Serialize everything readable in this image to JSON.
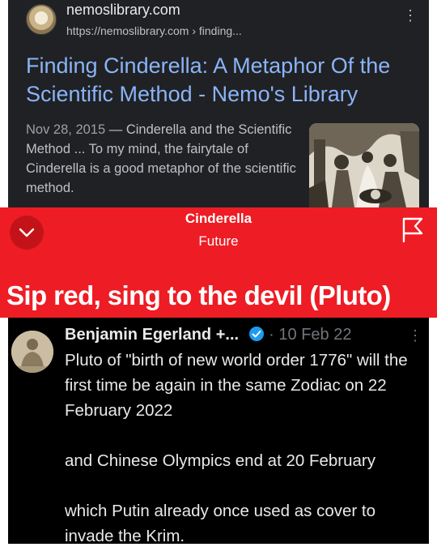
{
  "search_result": {
    "site_name": "nemoslibrary.com",
    "site_url": "https://nemoslibrary.com › finding...",
    "title": "Finding Cinderella: A Metaphor Of the Scientific Method - Nemo's Library",
    "date": "Nov 28, 2015",
    "snippet": " — Cinderella and the Scientific Method ... To my mind, the fairytale of Cinderella is a good metaphor of the scientific method.",
    "kebab_glyph": "⋮"
  },
  "red_header": {
    "title": "Cinderella",
    "subtitle": "Future",
    "headline": "Sip red, sing to the devil (Pluto)",
    "accent_color": "#ee1c24"
  },
  "tweet": {
    "author": "Benjamin Egerland +...",
    "separator": " · ",
    "date": "10 Feb 22",
    "kebab_glyph": "⋮",
    "paragraphs": [
      "Pluto of \"birth of new world order 1776\" will the first time be again in the same Zodiac on 22 February 2022",
      "and Chinese Olympics end at 20 February",
      "which Putin already once used as cover to invade the Krim."
    ]
  }
}
